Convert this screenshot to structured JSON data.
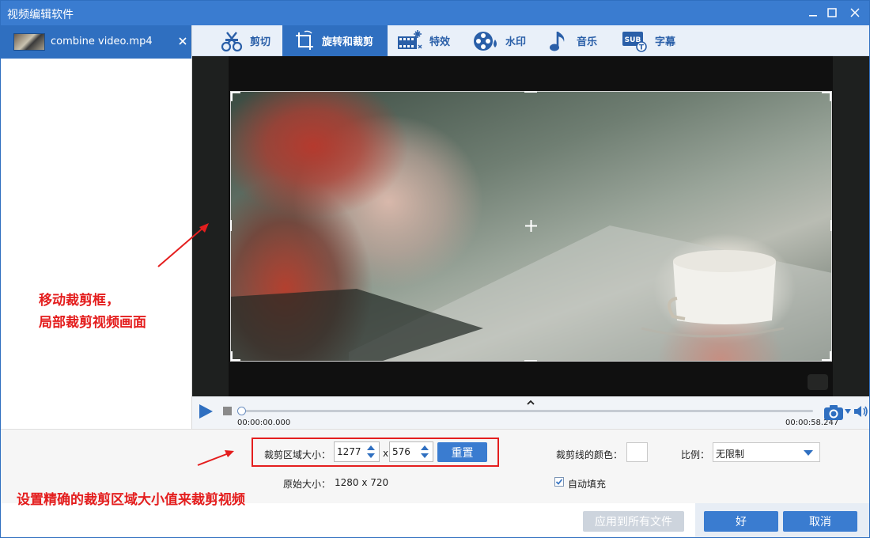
{
  "window": {
    "title": "视频编辑软件"
  },
  "file_list": {
    "items": [
      {
        "name": "combine video.mp4"
      }
    ]
  },
  "tabs": [
    {
      "label": "剪切",
      "icon": "cut-icon"
    },
    {
      "label": "旋转和裁剪",
      "icon": "rotate-crop-icon",
      "active": true
    },
    {
      "label": "特效",
      "icon": "effects-icon"
    },
    {
      "label": "水印",
      "icon": "watermark-icon"
    },
    {
      "label": "音乐",
      "icon": "music-icon"
    },
    {
      "label": "字幕",
      "icon": "subtitle-icon"
    }
  ],
  "playback": {
    "time_current": "00:00:00.000",
    "time_total": "00:00:58.247"
  },
  "settings": {
    "crop_size_label": "裁剪区域大小：",
    "width_value": "1277",
    "times": "x",
    "height_value": "576",
    "reset_label": "重置",
    "original_size_label": "原始大小：",
    "original_size_value": "1280 x 720",
    "crop_line_color_label": "裁剪线的颜色：",
    "ratio_label": "比例：",
    "ratio_value": "无限制",
    "auto_fill_label": "自动填充",
    "auto_fill_checked": true
  },
  "footer": {
    "apply_all_label": "应用到所有文件",
    "ok_label": "好",
    "cancel_label": "取消"
  },
  "annotations": {
    "crop_hint_line1": "移动裁剪框，",
    "crop_hint_line2": "局部裁剪视频画面",
    "size_hint": "设置精确的裁剪区域大小值来裁剪视频"
  },
  "colors": {
    "accent": "#3a7cd0",
    "annotation": "#e41e1e",
    "tab_bg": "#e9f0f9"
  }
}
